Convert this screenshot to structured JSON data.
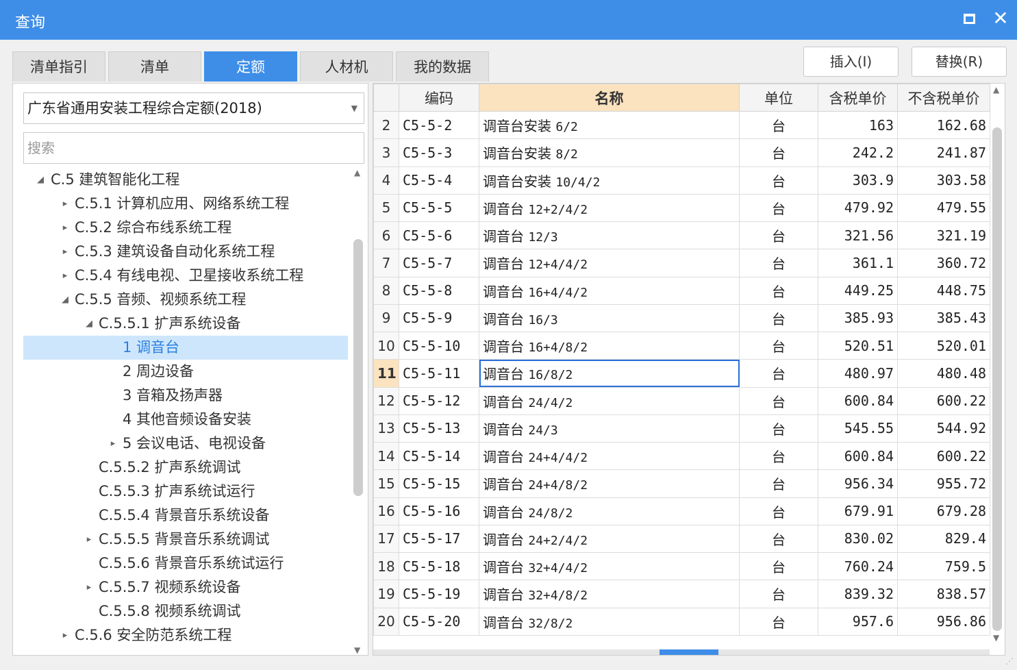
{
  "window": {
    "title": "查询"
  },
  "tabs": [
    {
      "label": "清单指引"
    },
    {
      "label": "清单"
    },
    {
      "label": "定额"
    },
    {
      "label": "人材机"
    },
    {
      "label": "我的数据"
    }
  ],
  "active_tab": 2,
  "actions": {
    "insert_label": "插入(I)",
    "replace_label": "替换(R)"
  },
  "left": {
    "library": "广东省通用安装工程综合定额(2018)",
    "search_placeholder": "搜索",
    "tree": [
      {
        "label": "C.5 建筑智能化工程",
        "level": 0,
        "arrow": "expanded"
      },
      {
        "label": "C.5.1 计算机应用、网络系统工程",
        "level": 1,
        "arrow": "collapsed"
      },
      {
        "label": "C.5.2 综合布线系统工程",
        "level": 1,
        "arrow": "collapsed"
      },
      {
        "label": "C.5.3 建筑设备自动化系统工程",
        "level": 1,
        "arrow": "collapsed"
      },
      {
        "label": "C.5.4 有线电视、卫星接收系统工程",
        "level": 1,
        "arrow": "collapsed"
      },
      {
        "label": "C.5.5 音频、视频系统工程",
        "level": 1,
        "arrow": "expanded"
      },
      {
        "label": "C.5.5.1 扩声系统设备",
        "level": 2,
        "arrow": "expanded"
      },
      {
        "label": "1 调音台",
        "level": 3,
        "arrow": "none",
        "selected": true
      },
      {
        "label": "2 周边设备",
        "level": 3,
        "arrow": "none"
      },
      {
        "label": "3 音箱及扬声器",
        "level": 3,
        "arrow": "none"
      },
      {
        "label": "4 其他音频设备安装",
        "level": 3,
        "arrow": "none"
      },
      {
        "label": "5 会议电话、电视设备",
        "level": 3,
        "arrow": "collapsed"
      },
      {
        "label": "C.5.5.2 扩声系统调试",
        "level": 2,
        "arrow": "none"
      },
      {
        "label": "C.5.5.3 扩声系统试运行",
        "level": 2,
        "arrow": "none"
      },
      {
        "label": "C.5.5.4 背景音乐系统设备",
        "level": 2,
        "arrow": "none"
      },
      {
        "label": "C.5.5.5 背景音乐系统调试",
        "level": 2,
        "arrow": "collapsed"
      },
      {
        "label": "C.5.5.6 背景音乐系统试运行",
        "level": 2,
        "arrow": "none"
      },
      {
        "label": "C.5.5.7 视频系统设备",
        "level": 2,
        "arrow": "collapsed"
      },
      {
        "label": "C.5.5.8 视频系统调试",
        "level": 2,
        "arrow": "none"
      },
      {
        "label": "C.5.6 安全防范系统工程",
        "level": 1,
        "arrow": "collapsed"
      }
    ]
  },
  "table": {
    "columns": [
      "",
      "编码",
      "名称",
      "单位",
      "含税单价",
      "不含税单价"
    ],
    "sorted_column": 2,
    "current_row": 11,
    "rows": [
      {
        "no": "2",
        "code": "C5-5-2",
        "name": "调音台安装",
        "spec": "6/2",
        "unit": "台",
        "price_tax": "163",
        "price_notax": "162.68"
      },
      {
        "no": "3",
        "code": "C5-5-3",
        "name": "调音台安装",
        "spec": "8/2",
        "unit": "台",
        "price_tax": "242.2",
        "price_notax": "241.87"
      },
      {
        "no": "4",
        "code": "C5-5-4",
        "name": "调音台安装",
        "spec": "10/4/2",
        "unit": "台",
        "price_tax": "303.9",
        "price_notax": "303.58"
      },
      {
        "no": "5",
        "code": "C5-5-5",
        "name": "调音台",
        "spec": "12+2/4/2",
        "unit": "台",
        "price_tax": "479.92",
        "price_notax": "479.55"
      },
      {
        "no": "6",
        "code": "C5-5-6",
        "name": "调音台",
        "spec": "12/3",
        "unit": "台",
        "price_tax": "321.56",
        "price_notax": "321.19"
      },
      {
        "no": "7",
        "code": "C5-5-7",
        "name": "调音台",
        "spec": "12+4/4/2",
        "unit": "台",
        "price_tax": "361.1",
        "price_notax": "360.72"
      },
      {
        "no": "8",
        "code": "C5-5-8",
        "name": "调音台",
        "spec": "16+4/4/2",
        "unit": "台",
        "price_tax": "449.25",
        "price_notax": "448.75"
      },
      {
        "no": "9",
        "code": "C5-5-9",
        "name": "调音台",
        "spec": "16/3",
        "unit": "台",
        "price_tax": "385.93",
        "price_notax": "385.43"
      },
      {
        "no": "10",
        "code": "C5-5-10",
        "name": "调音台",
        "spec": "16+4/8/2",
        "unit": "台",
        "price_tax": "520.51",
        "price_notax": "520.01"
      },
      {
        "no": "11",
        "code": "C5-5-11",
        "name": "调音台",
        "spec": "16/8/2",
        "unit": "台",
        "price_tax": "480.97",
        "price_notax": "480.48"
      },
      {
        "no": "12",
        "code": "C5-5-12",
        "name": "调音台",
        "spec": "24/4/2",
        "unit": "台",
        "price_tax": "600.84",
        "price_notax": "600.22"
      },
      {
        "no": "13",
        "code": "C5-5-13",
        "name": "调音台",
        "spec": "24/3",
        "unit": "台",
        "price_tax": "545.55",
        "price_notax": "544.92"
      },
      {
        "no": "14",
        "code": "C5-5-14",
        "name": "调音台",
        "spec": "24+4/4/2",
        "unit": "台",
        "price_tax": "600.84",
        "price_notax": "600.22"
      },
      {
        "no": "15",
        "code": "C5-5-15",
        "name": "调音台",
        "spec": "24+4/8/2",
        "unit": "台",
        "price_tax": "956.34",
        "price_notax": "955.72"
      },
      {
        "no": "16",
        "code": "C5-5-16",
        "name": "调音台",
        "spec": "24/8/2",
        "unit": "台",
        "price_tax": "679.91",
        "price_notax": "679.28"
      },
      {
        "no": "17",
        "code": "C5-5-17",
        "name": "调音台",
        "spec": "24+2/4/2",
        "unit": "台",
        "price_tax": "830.02",
        "price_notax": "829.4"
      },
      {
        "no": "18",
        "code": "C5-5-18",
        "name": "调音台",
        "spec": "32+4/4/2",
        "unit": "台",
        "price_tax": "760.24",
        "price_notax": "759.5"
      },
      {
        "no": "19",
        "code": "C5-5-19",
        "name": "调音台",
        "spec": "32+4/8/2",
        "unit": "台",
        "price_tax": "839.32",
        "price_notax": "838.57"
      },
      {
        "no": "20",
        "code": "C5-5-20",
        "name": "调音台",
        "spec": "32/8/2",
        "unit": "台",
        "price_tax": "957.6",
        "price_notax": "956.86"
      }
    ]
  },
  "icons": {
    "maximize": "maximize-icon",
    "close": "close-icon",
    "dropdown": "chevron-down-icon",
    "tree_expanded": "triangle-down-icon",
    "tree_collapsed": "triangle-right-icon"
  },
  "colors": {
    "accent": "#3e8ee8",
    "selection": "#cde6fc",
    "sorted_header": "#fbe3c0",
    "focus": "#2a6fd6"
  }
}
